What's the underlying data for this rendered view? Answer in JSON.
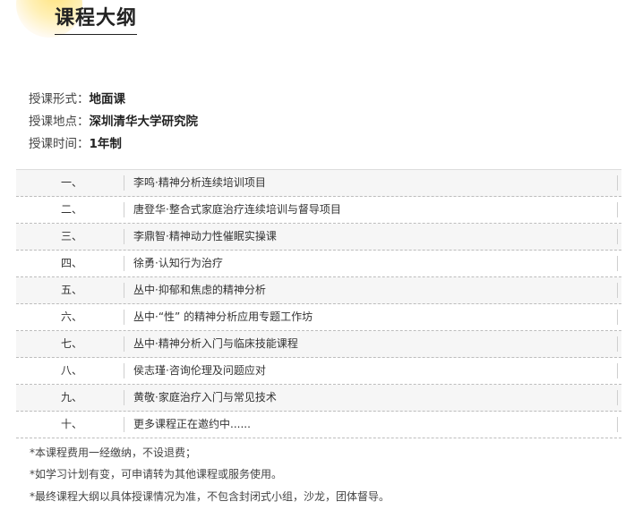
{
  "header": {
    "title": "课程大纲"
  },
  "info": [
    {
      "label": "授课形式：",
      "value": "地面课"
    },
    {
      "label": "授课地点：",
      "value": "深圳清华大学研究院"
    },
    {
      "label": "授课时间：",
      "value": "1年制"
    }
  ],
  "courses": [
    {
      "num": "一、",
      "name": "李鸣·精神分析连续培训项目"
    },
    {
      "num": "二、",
      "name": "唐登华·整合式家庭治疗连续培训与督导项目"
    },
    {
      "num": "三、",
      "name": "李鼎智·精神动力性催眠实操课"
    },
    {
      "num": "四、",
      "name": "徐勇·认知行为治疗"
    },
    {
      "num": "五、",
      "name": "丛中·抑郁和焦虑的精神分析"
    },
    {
      "num": "六、",
      "name": "丛中·“性” 的精神分析应用专题工作坊"
    },
    {
      "num": "七、",
      "name": "丛中·精神分析入门与临床技能课程"
    },
    {
      "num": "八、",
      "name": "侯志瑾·咨询伦理及问题应对"
    },
    {
      "num": "九、",
      "name": "黄敬·家庭治疗入门与常见技术"
    },
    {
      "num": "十、",
      "name": "更多课程正在邀约中......"
    }
  ],
  "notes": [
    "*本课程费用一经缴纳，不设退费；",
    "*如学习计划有变，可申请转为其他课程或服务使用。",
    "*最终课程大纲以具体授课情况为准，不包含封闭式小组，沙龙，团体督导。"
  ]
}
